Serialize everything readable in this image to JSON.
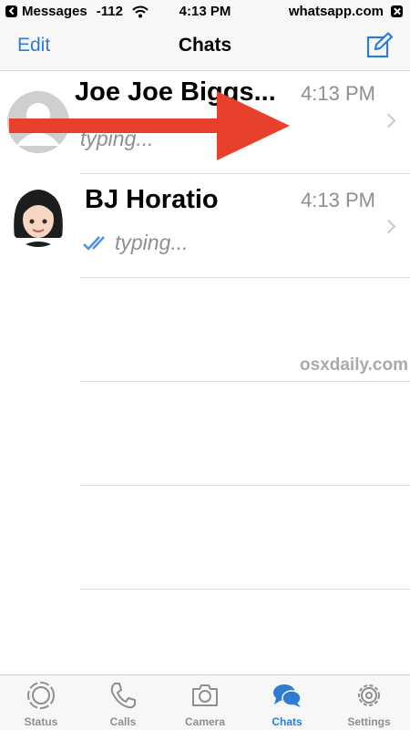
{
  "status_bar": {
    "back_app": "Messages",
    "signal": "-112",
    "time": "4:13 PM",
    "url": "whatsapp.com"
  },
  "nav": {
    "edit_label": "Edit",
    "title": "Chats",
    "compose_icon": "compose-icon"
  },
  "chats": [
    {
      "name": "Joe Joe Biggs...",
      "time": "4:13 PM",
      "preview": "typing...",
      "avatar": "default-avatar-icon"
    },
    {
      "name": "BJ Horatio",
      "time": "4:13 PM",
      "preview": "typing...",
      "avatar": "woman-emoji-avatar",
      "read_receipt": "double-check-icon"
    }
  ],
  "watermark": "osxdaily.com",
  "annotation": {
    "arrow_color": "#e8412b"
  },
  "tabs": [
    {
      "label": "Status",
      "icon": "status-icon"
    },
    {
      "label": "Calls",
      "icon": "phone-icon"
    },
    {
      "label": "Camera",
      "icon": "camera-icon"
    },
    {
      "label": "Chats",
      "icon": "chats-icon",
      "active": true
    },
    {
      "label": "Settings",
      "icon": "gear-icon"
    }
  ],
  "colors": {
    "accent": "#2f7cd2",
    "secondary_text": "#8e8e93",
    "bar_bg": "#f7f7f7"
  }
}
